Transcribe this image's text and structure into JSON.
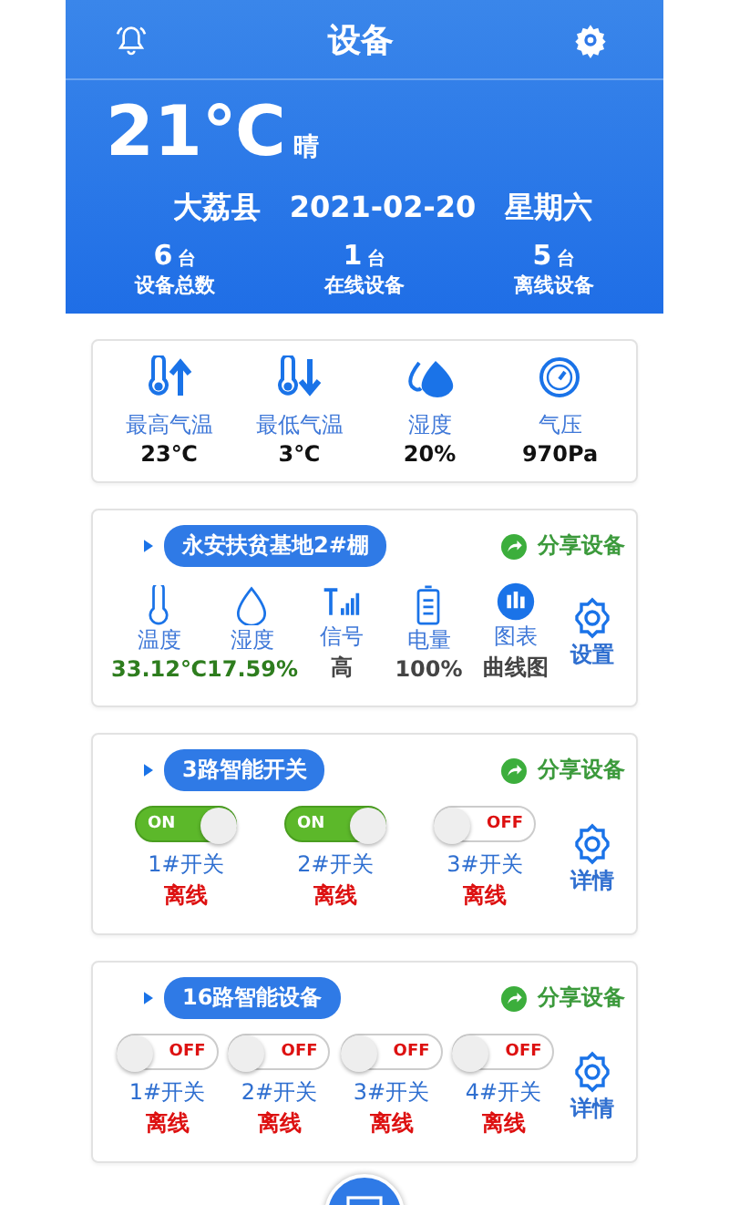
{
  "header": {
    "title": "设备",
    "temperature": "21℃",
    "weather": "晴",
    "location": "大荔县",
    "date": "2021-02-20",
    "weekday": "星期六",
    "stats": [
      {
        "count": "6",
        "unit": "台",
        "label": "设备总数"
      },
      {
        "count": "1",
        "unit": "台",
        "label": "在线设备"
      },
      {
        "count": "5",
        "unit": "台",
        "label": "离线设备"
      }
    ]
  },
  "weather": [
    {
      "kind": "max_temp",
      "label": "最高气温",
      "value": "23℃"
    },
    {
      "kind": "min_temp",
      "label": "最低气温",
      "value": "3℃"
    },
    {
      "kind": "humidity",
      "label": "湿度",
      "value": "20%"
    },
    {
      "kind": "pressure",
      "label": "气压",
      "value": "970Pa"
    }
  ],
  "devices": [
    {
      "kind": "sensor",
      "name": "永安扶贫基地2#棚",
      "share": "分享设备",
      "action": "设置",
      "readings": [
        {
          "kind": "temperature",
          "label": "温度",
          "value": "33.12℃",
          "color": "#2e7d1e"
        },
        {
          "kind": "humidity",
          "label": "湿度",
          "value": "17.59%",
          "color": "#2e7d1e"
        },
        {
          "kind": "signal",
          "label": "信号",
          "value": "高",
          "color": "#444444"
        },
        {
          "kind": "battery",
          "label": "电量",
          "value": "100%",
          "color": "#444444"
        },
        {
          "kind": "chart",
          "label": "图表",
          "value": "曲线图",
          "color": "#444444"
        }
      ]
    },
    {
      "kind": "switch",
      "name": "3路智能开关",
      "share": "分享设备",
      "action": "详情",
      "switches": [
        {
          "name": "1#开关",
          "on": true,
          "toggle_text": "ON",
          "status": "离线"
        },
        {
          "name": "2#开关",
          "on": true,
          "toggle_text": "ON",
          "status": "离线"
        },
        {
          "name": "3#开关",
          "on": false,
          "toggle_text": "OFF",
          "status": "离线"
        }
      ]
    },
    {
      "kind": "switch",
      "name": "16路智能设备",
      "share": "分享设备",
      "action": "详情",
      "switches": [
        {
          "name": "1#开关",
          "on": false,
          "toggle_text": "OFF",
          "status": "离线"
        },
        {
          "name": "2#开关",
          "on": false,
          "toggle_text": "OFF",
          "status": "离线"
        },
        {
          "name": "3#开关",
          "on": false,
          "toggle_text": "OFF",
          "status": "离线"
        },
        {
          "name": "4#开关",
          "on": false,
          "toggle_text": "OFF",
          "status": "离线"
        }
      ]
    }
  ]
}
